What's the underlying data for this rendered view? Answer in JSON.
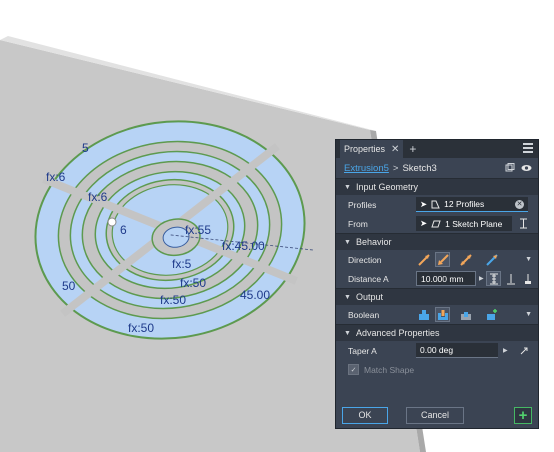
{
  "viewport": {
    "dimensions": [
      "5",
      "fx:6",
      "fx:6",
      "6",
      "fx:55",
      "fx:45.00",
      "fx:5",
      "fx:50",
      "45.00",
      "fx:50",
      "fx:50",
      "50"
    ]
  },
  "panel": {
    "tab_label": "Properties",
    "breadcrumb": {
      "feature": "Extrusion5",
      "separator": ">",
      "sketch": "Sketch3"
    },
    "sections": {
      "input": "Input Geometry",
      "behavior": "Behavior",
      "output": "Output",
      "advanced": "Advanced Properties"
    },
    "profiles": {
      "label": "Profiles",
      "value": "12 Profiles"
    },
    "from": {
      "label": "From",
      "value": "1 Sketch Plane"
    },
    "direction": {
      "label": "Direction"
    },
    "distance": {
      "label": "Distance A",
      "value": "10.000 mm"
    },
    "boolean": {
      "label": "Boolean"
    },
    "taper": {
      "label": "Taper A",
      "value": "0.00 deg"
    },
    "match_shape": {
      "label": "Match Shape"
    },
    "buttons": {
      "ok": "OK",
      "cancel": "Cancel",
      "add": "+"
    }
  },
  "colors": {
    "accent": "#4aa6e8",
    "panel_bg": "#3b4453",
    "add_green": "#52d16e",
    "profile_fill": "#b7d3f5"
  }
}
